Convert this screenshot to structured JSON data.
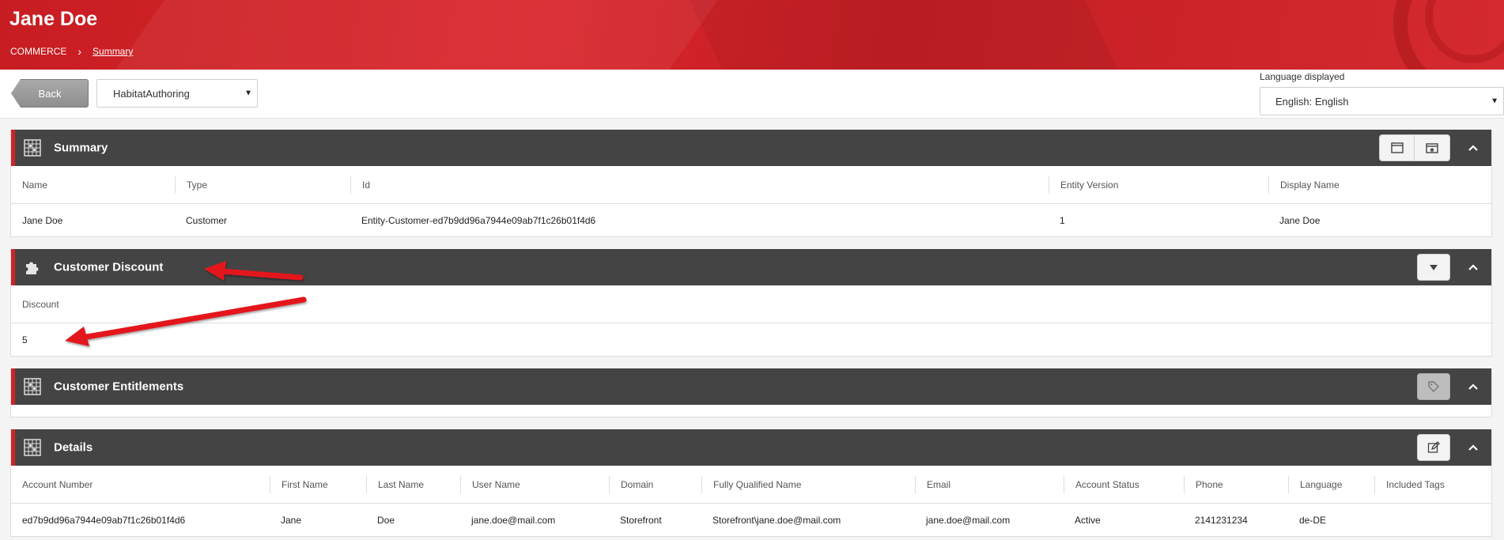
{
  "header": {
    "title": "Jane Doe",
    "breadcrumb": {
      "root": "COMMERCE",
      "separator": "›",
      "current": "Summary"
    }
  },
  "toolbar": {
    "back_label": "Back",
    "catalog_select": {
      "value": "HabitatAuthoring"
    },
    "language": {
      "label": "Language displayed",
      "value": "English: English"
    }
  },
  "icons": {
    "grid": "grid-icon",
    "puzzle": "puzzle-icon",
    "window": "window-icon",
    "calendar": "calendar-star-icon",
    "tag": "tag-icon",
    "edit": "edit-icon",
    "chevron_up": "chevron-up-icon",
    "chevron_down": "chevron-down-icon"
  },
  "colors": {
    "accent": "#d0222a",
    "panel_header": "#444444",
    "header_bg": "#d02227"
  },
  "panels": {
    "summary": {
      "title": "Summary",
      "columns": [
        "Name",
        "Type",
        "Id",
        "Entity Version",
        "Display Name"
      ],
      "row": [
        "Jane Doe",
        "Customer",
        "Entity-Customer-ed7b9dd96a7944e09ab7f1c26b01f4d6",
        "1",
        "Jane Doe"
      ]
    },
    "discount": {
      "title": "Customer Discount",
      "columns": [
        "Discount"
      ],
      "row": [
        "5"
      ]
    },
    "entitlements": {
      "title": "Customer Entitlements"
    },
    "details": {
      "title": "Details",
      "columns": [
        "Account Number",
        "First Name",
        "Last Name",
        "User Name",
        "Domain",
        "Fully Qualified Name",
        "Email",
        "Account Status",
        "Phone",
        "Language",
        "Included Tags"
      ],
      "row": [
        "ed7b9dd96a7944e09ab7f1c26b01f4d6",
        "Jane",
        "Doe",
        "jane.doe@mail.com",
        "Storefront",
        "Storefront\\jane.doe@mail.com",
        "jane.doe@mail.com",
        "Active",
        "2141231234",
        "de-DE",
        ""
      ]
    }
  }
}
